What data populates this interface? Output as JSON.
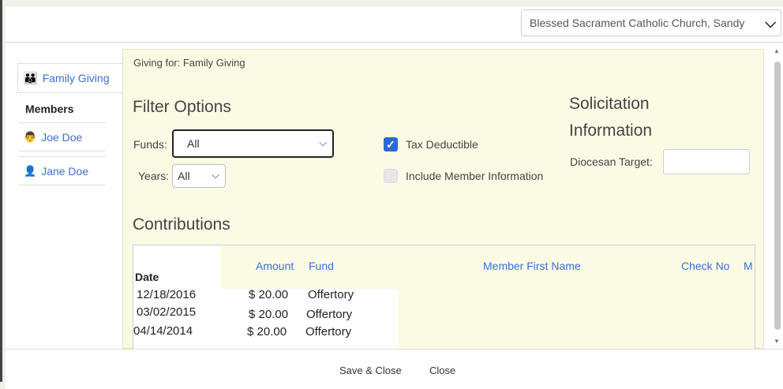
{
  "header": {
    "church_select_value": "Blessed Sacrament Catholic Church, Sandy"
  },
  "sidebar": {
    "family_tab_label": "Family Giving",
    "members_heading": "Members",
    "members": [
      {
        "name": "Joe Doe",
        "icon": "male-person-icon"
      },
      {
        "name": "Jane Doe",
        "icon": "female-person-icon"
      }
    ]
  },
  "panel": {
    "giving_for": "Giving for: Family Giving",
    "filter_heading": "Filter Options",
    "funds_label": "Funds:",
    "funds_value": "All",
    "years_label": "Years:",
    "years_value": "All",
    "tax_deductible_label": "Tax Deductible",
    "tax_deductible_checked": true,
    "include_member_label": "Include Member Information",
    "include_member_checked": false,
    "solicitation_heading_line1": "Solicitation",
    "solicitation_heading_line2": "Information",
    "diocesan_target_label": "Diocesan Target:",
    "diocesan_target_value": ""
  },
  "contributions": {
    "heading": "Contributions",
    "columns": {
      "date": "Date",
      "amount": "Amount",
      "fund": "Fund",
      "member_first_name": "Member First Name",
      "check_no": "Check No",
      "truncated": "M"
    },
    "rows": [
      {
        "date": "12/18/2016",
        "amount": "$ 20.00",
        "fund": "Offertory"
      },
      {
        "date": "03/02/2015",
        "amount": "$ 20.00",
        "fund": "Offertory"
      },
      {
        "date": "04/14/2014",
        "amount": "$ 20.00",
        "fund": "Offertory"
      }
    ]
  },
  "footer": {
    "save_close_label": "Save & Close",
    "close_label": "Close"
  },
  "colors": {
    "panel_bg": "#fbfbe5",
    "link_blue": "#3d6fd1",
    "checkbox_blue": "#2a6ad4"
  }
}
